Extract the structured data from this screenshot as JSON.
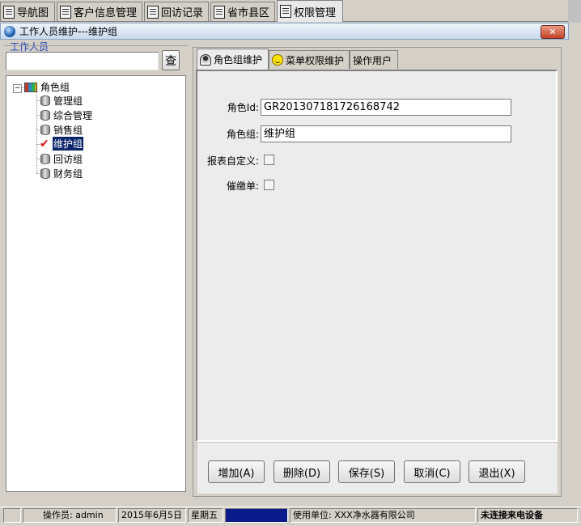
{
  "top_tabs": [
    {
      "label": "导航图",
      "icon": "document-icon",
      "active": false
    },
    {
      "label": "客户信息管理",
      "icon": "document-icon",
      "active": false
    },
    {
      "label": "回访记录",
      "icon": "document-icon",
      "active": false
    },
    {
      "label": "省市县区",
      "icon": "document-icon",
      "active": false
    },
    {
      "label": "权限管理",
      "icon": "document-icon",
      "active": true
    }
  ],
  "window": {
    "title": "工作人员维护---维护组",
    "close_label": "✕"
  },
  "left": {
    "group_label": "工作人员",
    "search_value": "",
    "search_button": "查",
    "tree": {
      "root": "角色组",
      "expander": "−",
      "items": [
        {
          "label": "管理组",
          "selected": false
        },
        {
          "label": "综合管理",
          "selected": false
        },
        {
          "label": "销售组",
          "selected": false
        },
        {
          "label": "维护组",
          "selected": true
        },
        {
          "label": "回访组",
          "selected": false
        },
        {
          "label": "财务组",
          "selected": false
        }
      ]
    }
  },
  "inner_tabs": [
    {
      "label": "角色组维护",
      "icon": "role-icon",
      "active": true
    },
    {
      "label": "菜单权限维护",
      "icon": "smiley-icon",
      "active": false
    },
    {
      "label": "操作用户",
      "icon": "",
      "active": false
    }
  ],
  "form": {
    "role_id_label": "角色Id:",
    "role_id_value": "GR201307181726168742",
    "role_group_label": "角色组:",
    "role_group_value": "维护组",
    "report_custom_label": "报表自定义:",
    "report_custom_checked": false,
    "collect_label": "催缴单:",
    "collect_checked": false
  },
  "buttons": {
    "add": "增加(A)",
    "delete": "删除(D)",
    "save": "保存(S)",
    "cancel": "取消(C)",
    "exit": "退出(X)"
  },
  "status": {
    "operator": "操作员: admin",
    "date": "2015年6月5日",
    "weekday": "星期五",
    "unit": "使用单位: XXX净水器有限公司",
    "device": "未连接来电设备"
  },
  "colors": {
    "selection": "#0a246a",
    "status_block": "#0a1a8a",
    "group_label": "#1c3fb6"
  }
}
